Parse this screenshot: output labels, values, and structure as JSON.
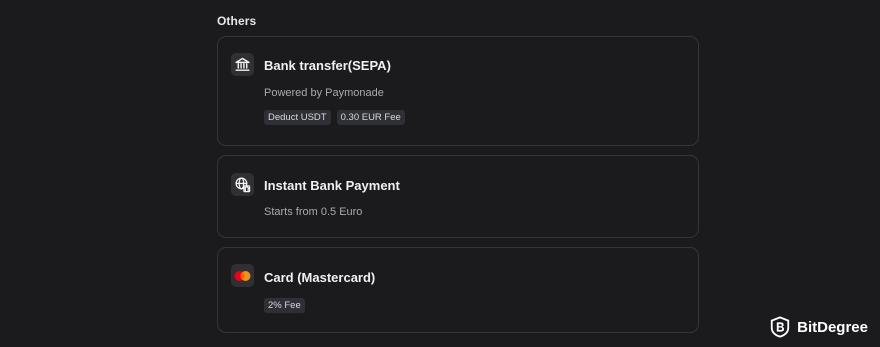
{
  "section": {
    "title": "Others"
  },
  "methods": [
    {
      "icon": "bank-icon",
      "title": "Bank transfer(SEPA)",
      "subtitle": "Powered by Paymonade",
      "badges": [
        "Deduct USDT",
        "0.30 EUR Fee"
      ]
    },
    {
      "icon": "globe-bank-icon",
      "title": "Instant Bank Payment",
      "subtitle": "Starts from 0.5 Euro",
      "badges": []
    },
    {
      "icon": "mastercard-icon",
      "title": "Card (Mastercard)",
      "subtitle": "",
      "badges": [
        "2% Fee"
      ]
    }
  ],
  "colors": {
    "background": "#1b1b1e",
    "card_border": "#34343a",
    "badge_bg": "#2f3036",
    "mastercard_red": "#eb001b",
    "mastercard_orange": "#f79e1b"
  },
  "watermark": {
    "text": "BitDegree",
    "icon": "bitdegree-logo-icon"
  }
}
